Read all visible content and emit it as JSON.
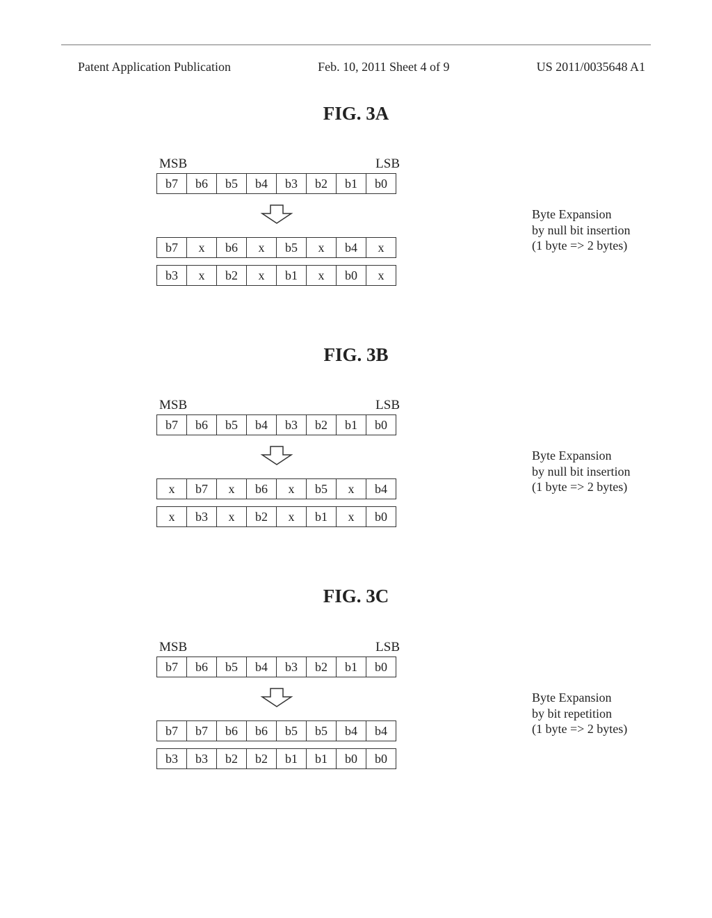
{
  "header": {
    "left": "Patent Application Publication",
    "center": "Feb. 10, 2011  Sheet 4 of 9",
    "right": "US 2011/0035648 A1"
  },
  "figA": {
    "title": "FIG. 3A",
    "msb": "MSB",
    "lsb": "LSB",
    "row_in": [
      "b7",
      "b6",
      "b5",
      "b4",
      "b3",
      "b2",
      "b1",
      "b0"
    ],
    "row_out1": [
      "b7",
      "x",
      "b6",
      "x",
      "b5",
      "x",
      "b4",
      "x"
    ],
    "row_out2": [
      "b3",
      "x",
      "b2",
      "x",
      "b1",
      "x",
      "b0",
      "x"
    ],
    "side": [
      "Byte Expansion",
      "by null bit insertion",
      "(1 byte => 2 bytes)"
    ]
  },
  "figB": {
    "title": "FIG. 3B",
    "msb": "MSB",
    "lsb": "LSB",
    "row_in": [
      "b7",
      "b6",
      "b5",
      "b4",
      "b3",
      "b2",
      "b1",
      "b0"
    ],
    "row_out1": [
      "x",
      "b7",
      "x",
      "b6",
      "x",
      "b5",
      "x",
      "b4"
    ],
    "row_out2": [
      "x",
      "b3",
      "x",
      "b2",
      "x",
      "b1",
      "x",
      "b0"
    ],
    "side": [
      "Byte Expansion",
      "by null bit insertion",
      "(1 byte => 2 bytes)"
    ]
  },
  "figC": {
    "title": "FIG. 3C",
    "msb": "MSB",
    "lsb": "LSB",
    "row_in": [
      "b7",
      "b6",
      "b5",
      "b4",
      "b3",
      "b2",
      "b1",
      "b0"
    ],
    "row_out1": [
      "b7",
      "b7",
      "b6",
      "b6",
      "b5",
      "b5",
      "b4",
      "b4"
    ],
    "row_out2": [
      "b3",
      "b3",
      "b2",
      "b2",
      "b1",
      "b1",
      "b0",
      "b0"
    ],
    "side": [
      "Byte Expansion",
      "by bit repetition",
      "(1 byte => 2 bytes)"
    ]
  },
  "chart_data": {
    "type": "table",
    "title": "Byte Expansion schemes (1 byte => 2 bytes)",
    "figures": [
      {
        "label": "FIG. 3A",
        "input_byte": [
          "b7",
          "b6",
          "b5",
          "b4",
          "b3",
          "b2",
          "b1",
          "b0"
        ],
        "output_bytes": [
          [
            "b7",
            "x",
            "b6",
            "x",
            "b5",
            "x",
            "b4",
            "x"
          ],
          [
            "b3",
            "x",
            "b2",
            "x",
            "b1",
            "x",
            "b0",
            "x"
          ]
        ],
        "method": "null bit insertion (x after each bit)"
      },
      {
        "label": "FIG. 3B",
        "input_byte": [
          "b7",
          "b6",
          "b5",
          "b4",
          "b3",
          "b2",
          "b1",
          "b0"
        ],
        "output_bytes": [
          [
            "x",
            "b7",
            "x",
            "b6",
            "x",
            "b5",
            "x",
            "b4"
          ],
          [
            "x",
            "b3",
            "x",
            "b2",
            "x",
            "b1",
            "x",
            "b0"
          ]
        ],
        "method": "null bit insertion (x before each bit)"
      },
      {
        "label": "FIG. 3C",
        "input_byte": [
          "b7",
          "b6",
          "b5",
          "b4",
          "b3",
          "b2",
          "b1",
          "b0"
        ],
        "output_bytes": [
          [
            "b7",
            "b7",
            "b6",
            "b6",
            "b5",
            "b5",
            "b4",
            "b4"
          ],
          [
            "b3",
            "b3",
            "b2",
            "b2",
            "b1",
            "b1",
            "b0",
            "b0"
          ]
        ],
        "method": "bit repetition"
      }
    ]
  }
}
